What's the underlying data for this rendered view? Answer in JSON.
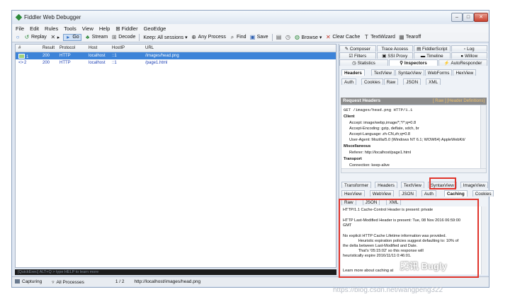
{
  "window": {
    "title": "Fiddler Web Debugger"
  },
  "menu": [
    "File",
    "Edit",
    "Rules",
    "Tools",
    "View",
    "Help",
    "⊞ Fiddler",
    "GeoEdge"
  ],
  "toolbar": [
    {
      "icon": "○",
      "label": ""
    },
    {
      "icon": "↺",
      "label": "Replay"
    },
    {
      "icon": "✕",
      "label": "▸"
    },
    {
      "icon": "▸",
      "label": "Go"
    },
    {
      "icon": "♣",
      "label": "Stream"
    },
    {
      "icon": "⊞",
      "label": "Decode"
    },
    {
      "icon": "",
      "label": "Keep: All sessions ▾"
    },
    {
      "icon": "⊕",
      "label": "Any Process"
    },
    {
      "icon": "⌕",
      "label": "Find"
    },
    {
      "icon": "▣",
      "label": "Save"
    },
    {
      "icon": "▤",
      "label": ""
    },
    {
      "icon": "◷",
      "label": ""
    },
    {
      "icon": "◍",
      "label": "Browse ▾"
    },
    {
      "icon": "✕",
      "label": "Clear Cache"
    },
    {
      "icon": "T",
      "label": "TextWizard"
    },
    {
      "icon": "▦",
      "label": "Tearoff"
    }
  ],
  "sessions": {
    "columns": [
      "#",
      "Result",
      "Protocol",
      "Host",
      "HostIP",
      "URL"
    ],
    "rows": [
      {
        "num": "1",
        "result": "200",
        "protocol": "HTTP",
        "host": "localhost",
        "hostip": "::1",
        "url": "/images/head.png"
      },
      {
        "num": "2",
        "result": "200",
        "protocol": "HTTP",
        "host": "localhost",
        "hostip": "::1",
        "url": "/page1.html"
      }
    ]
  },
  "quickexec": "[QuickExec] ALT+Q > type HELP to learn more",
  "status": {
    "capturing": "Capturing",
    "processes": "All Processes",
    "count": "1 / 2",
    "url": "http://localhost/images/head.png"
  },
  "right_tabs_top": [
    [
      "Composer",
      "Trace Access",
      "FiddlerScript",
      "Log"
    ],
    [
      "Filters",
      "SSI Proxy",
      "Timeline",
      "Willow"
    ],
    [
      "Statistics",
      "Inspectors",
      "AutoResponder"
    ]
  ],
  "request_tabs": [
    [
      "Headers",
      "TextView",
      "SyntaxView",
      "WebForms",
      "HexView"
    ],
    [
      "Auth",
      "Cookies",
      "Raw",
      "JSON",
      "XML"
    ]
  ],
  "request_header": {
    "title": "Request Headers",
    "links": "[ Raw ] [Header Definitions]"
  },
  "request_lines": [
    {
      "t": "GET /images/head.png HTTP/1.1",
      "bold": false,
      "indent": 0
    },
    {
      "t": "Client",
      "bold": true,
      "indent": 0
    },
    {
      "t": "Accept: image/webp,image/*,*/*;q=0.8",
      "bold": false,
      "indent": 1
    },
    {
      "t": "Accept-Encoding: gzip, deflate, sdch, br",
      "bold": false,
      "indent": 1
    },
    {
      "t": "Accept-Language: zh-CN,zh;q=0.8",
      "bold": false,
      "indent": 1
    },
    {
      "t": "User-Agent: Mozilla/5.0 (Windows NT 6.1; WOW64) AppleWebKit/",
      "bold": false,
      "indent": 1
    },
    {
      "t": "Miscellaneous",
      "bold": true,
      "indent": 0
    },
    {
      "t": "Referer: http://localhost/page1.html",
      "bold": false,
      "indent": 1
    },
    {
      "t": "Transport",
      "bold": true,
      "indent": 0
    },
    {
      "t": "Connection: keep-alive",
      "bold": false,
      "indent": 1
    }
  ],
  "response_tabs": [
    [
      "Transformer",
      "Headers",
      "TextView",
      "SyntaxView",
      "ImageView"
    ],
    [
      "HexView",
      "WebView",
      "JSON",
      "Auth",
      "Caching",
      "Cookies"
    ],
    [
      "Raw",
      "JSON",
      "XML"
    ]
  ],
  "response_lines": [
    "HTTP/1.1 Cache-Control Header is present: private",
    "",
    "HTTP Last-Modified Header is present: Tue, 08 Nov 2016 06:59:00",
    "GMT",
    "",
    "No explicit HTTP Cache Lifetime information was provided.",
    "              Heuristic expiration policies suggest defaulting to: 10% of",
    "the delta between Last-Modified and Date.",
    "              That's '05:15:02' so this response will",
    "heuristically expire 2016/11/11 0:46:01.",
    "",
    "",
    "",
    "Learn more about caching at"
  ],
  "watermark": {
    "logo": "腾讯 Bugly",
    "url": "https://blog.csdn.net/wangpeng322"
  }
}
